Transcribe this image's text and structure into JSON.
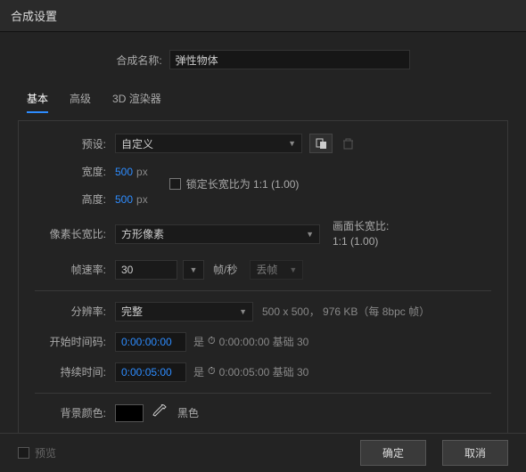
{
  "title": "合成设置",
  "compName": {
    "label": "合成名称:",
    "value": "弹性物体"
  },
  "tabs": {
    "basic": "基本",
    "advanced": "高级",
    "renderer": "3D 渲染器"
  },
  "preset": {
    "label": "预设:",
    "value": "自定义"
  },
  "width": {
    "label": "宽度:",
    "value": "500",
    "unit": "px"
  },
  "height": {
    "label": "高度:",
    "value": "500",
    "unit": "px"
  },
  "lockAspect": "锁定长宽比为 1:1 (1.00)",
  "pixelAspect": {
    "label": "像素长宽比:",
    "value": "方形像素"
  },
  "frameAspect": {
    "label": "画面长宽比:",
    "value": "1:1 (1.00)"
  },
  "frameRate": {
    "label": "帧速率:",
    "value": "30",
    "unit": "帧/秒",
    "drop": "丢帧"
  },
  "resolution": {
    "label": "分辨率:",
    "value": "完整",
    "info": "500 x 500， 976 KB（每 8bpc 帧）"
  },
  "start": {
    "label": "开始时间码:",
    "value": "0:00:00:00",
    "meta": "0:00:00:00 基础 30"
  },
  "duration": {
    "label": "持续时间:",
    "value": "0:00:05:00",
    "meta": "0:00:05:00 基础 30"
  },
  "bg": {
    "label": "背景颜色:",
    "name": "黑色",
    "hex": "#000000"
  },
  "footer": {
    "preview": "预览",
    "ok": "确定",
    "cancel": "取消"
  },
  "is": "是"
}
